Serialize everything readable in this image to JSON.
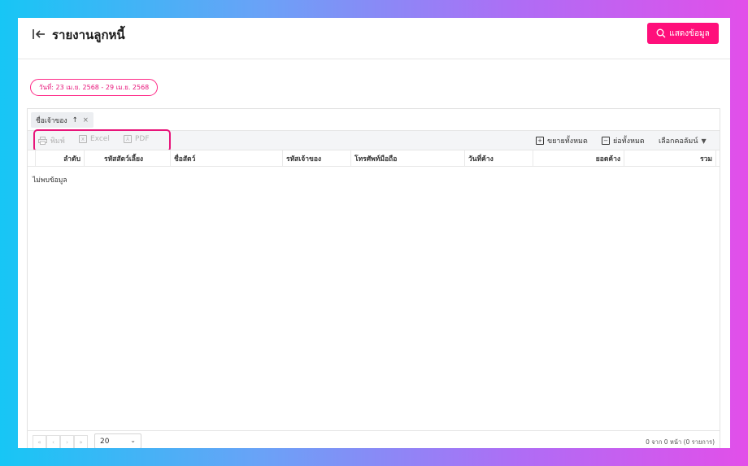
{
  "header": {
    "title": "รายงานลูกหนี้",
    "show_button": "แสดงข้อมูล"
  },
  "filter": {
    "date_chip": "วันที่: 23 เม.ย. 2568 - 29 เม.ย. 2568"
  },
  "grid": {
    "group_chip": "ชื่อเจ้าของ",
    "toolbar": {
      "print": "พิมพ์",
      "excel": "Excel",
      "pdf": "PDF",
      "expand_all": "ขยายทั้งหมด",
      "collapse_all": "ย่อทั้งหมด",
      "choose_columns": "เลือกคอลัมน์"
    },
    "columns": [
      "ลำดับ",
      "รหัสสัตว์เลี้ยง",
      "ชื่อสัตว์",
      "รหัสเจ้าของ",
      "โทรศัพท์มือถือ",
      "วันที่ค้าง",
      "ยอดค้าง",
      "รวม"
    ],
    "empty_text": "ไม่พบข้อมูล"
  },
  "footer": {
    "page_size": "20",
    "page_info": "0 จาก 0 หน้า (0 รายการ)"
  },
  "colors": {
    "accent": "#ff0f7b"
  }
}
